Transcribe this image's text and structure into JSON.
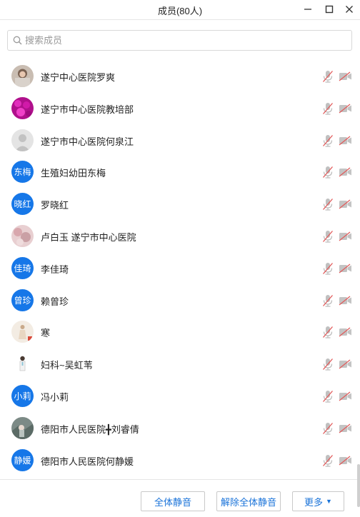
{
  "window": {
    "title": "成员(80人)",
    "minimize_icon": "minimize-icon",
    "maximize_icon": "maximize-icon",
    "close_icon": "close-icon"
  },
  "search": {
    "placeholder": "搜索成员",
    "value": "",
    "icon": "search-icon"
  },
  "colors": {
    "accent": "#1677e8",
    "muted_red": "#e25a5a",
    "icon_gray": "#b8b8b8"
  },
  "members": [
    {
      "name": "遂宁中心医院罗爽",
      "avatar": "photo-woman",
      "avatar_text": ""
    },
    {
      "name": "遂宁市中心医院教培部",
      "avatar": "photo-magenta",
      "avatar_text": ""
    },
    {
      "name": "遂宁市中心医院何泉江",
      "avatar": "default-person",
      "avatar_text": ""
    },
    {
      "name": "生殖妇幼田东梅",
      "avatar": "text",
      "avatar_text": "东梅"
    },
    {
      "name": "罗晓红",
      "avatar": "text",
      "avatar_text": "晓红"
    },
    {
      "name": "卢白玉  遂宁市中心医院",
      "avatar": "photo-flowers",
      "avatar_text": ""
    },
    {
      "name": "李佳琦",
      "avatar": "text",
      "avatar_text": "佳琦"
    },
    {
      "name": "赖曾珍",
      "avatar": "text",
      "avatar_text": "曾珍"
    },
    {
      "name": "寒",
      "avatar": "photo-figure",
      "avatar_text": ""
    },
    {
      "name": "妇科~吴虹苇",
      "avatar": "photo-doctor",
      "avatar_text": ""
    },
    {
      "name": "冯小莉",
      "avatar": "text",
      "avatar_text": "小莉"
    },
    {
      "name": "德阳市人民医院╋刘睿倩",
      "avatar": "photo-landscape",
      "avatar_text": ""
    },
    {
      "name": "德阳市人民医院何静媛",
      "avatar": "text",
      "avatar_text": "静媛"
    }
  ],
  "row_icons": {
    "mic": "mic-muted-icon",
    "camera": "camera-off-icon"
  },
  "footer": {
    "mute_all": "全体静音",
    "unmute_all": "解除全体静音",
    "more": "更多",
    "more_caret": "▼"
  }
}
